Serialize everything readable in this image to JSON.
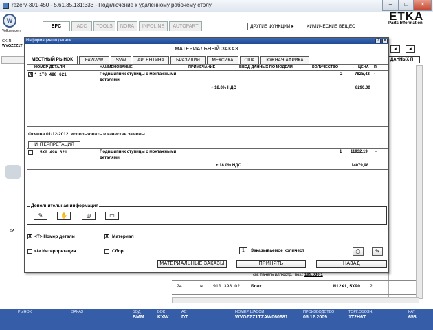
{
  "rdp": {
    "title": "rezerv-301-450 - 5.61.35.131:333 - Подключение к удаленному рабочему столу",
    "min": "–",
    "max": "□",
    "close": "✕"
  },
  "etka": {
    "brand": "Volkswagen",
    "logo_text": "ETKA",
    "logo_sub": "Parts Information",
    "tabs": [
      "EPC",
      "ACC",
      "TOOLS",
      "NORA",
      "INFOLINE",
      "AUTOPART"
    ],
    "other_functions": "ДРУГИЕ ФУНКЦИИ ▸",
    "chemicals": "ХИМИЧЕСКИЕ ВЕЩЕС",
    "left_tag_1": "CK-R",
    "left_tag_2": "WVGZZZ1T",
    "right_tag": "ДАННЫХ П",
    "bg_note": "см. панель иллюстр., поз.:",
    "bg_note_ref": "199.030.1",
    "bg_row": {
      "pos": "24",
      "mark": "н",
      "part": "910 398 02",
      "name": "Болт",
      "spec": "M12X1,5X90",
      "qty": "2"
    }
  },
  "status": {
    "items": [
      {
        "label": "РЫНОК",
        "value": ""
      },
      {
        "label": "ЗАКАЗ",
        "value": ""
      },
      {
        "label": "БОД",
        "value": "BMM"
      },
      {
        "label": "БОК",
        "value": "KXW"
      },
      {
        "label": "АС",
        "value": "DT"
      },
      {
        "label": "НОМЕР ШАССИ",
        "value": "WVGZZZ1TZAW060681"
      },
      {
        "label": "ПРОИЗВОДСТВО",
        "value": "05.12.2009"
      },
      {
        "label": "ТОРГ.ОБОЗН.",
        "value": "1T2H6T"
      },
      {
        "label": "КАТ",
        "value": "658"
      }
    ]
  },
  "dialog": {
    "title": "Информация по детали",
    "heading": "МАТЕРИАЛЬНЫЙ ЗАКАЗ",
    "market_tabs": [
      "МЕСТНЫЙ РЫНОК",
      "FAW-VW",
      "SVW",
      "АРГЕНТИНА",
      "БРАЗИЛИЯ",
      "МЕКСИКА",
      "США",
      "ЮЖНАЯ АФРИКА"
    ],
    "columns": {
      "part_no": "НОМЕР ДЕТАЛИ",
      "name": "НАИМЕНОВАНИЕ",
      "note": "ПРИМЕЧАНИЕ",
      "model_input": "ВВОД ДАННЫХ ПО МОДЕЛИ",
      "qty": "КОЛИЧЕСТВО",
      "price": "ЦЕНА",
      "r": "R"
    },
    "order_row": {
      "checked": "X",
      "part_no": "* 1T0 498 621",
      "name_1": "Подвшипник ступицы с монтажными",
      "name_2": "деталями",
      "qty": "2",
      "price": "7825,42",
      "r": "-",
      "vat_label": "+ 18.0% НДС",
      "vat_price": "8290,00"
    },
    "cancel_note": "Отмена 01/12/2012, использовать в качестве замены",
    "interp_tab": "ИНТЕРПРЕТАЦИЯ",
    "interp_row": {
      "part_no": "5K0 498 621",
      "name_1": "Подвшипник ступицы с монтажными",
      "name_2": "деталями",
      "qty": "1",
      "price": "11932,19",
      "r": "-",
      "vat_label": "+ 18.0% НДС",
      "vat_price": "14079,98"
    },
    "additional_info": "Дополнительная информация",
    "options": {
      "part_no": "<T> Номер детали",
      "material": "Материал",
      "interpretation": "<I> Интерпретация",
      "collect": "Сбор"
    },
    "qty_value": "1",
    "qty_label": "Заказываемое количест",
    "buttons": {
      "orders": "МАТЕРИАЛЬНЫЕ ЗАКАЗЫ",
      "accept": "ПРИНЯТЬ",
      "back": "НАЗАД"
    },
    "titlebar_help": "?",
    "titlebar_close": "✕"
  }
}
